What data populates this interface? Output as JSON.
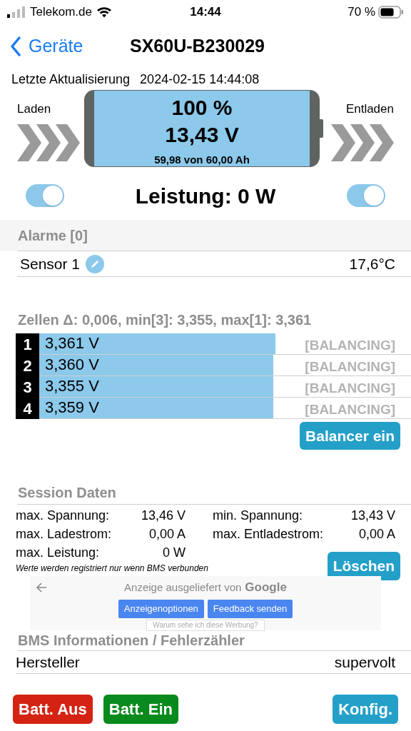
{
  "status_bar": {
    "carrier": "Telekom.de",
    "time": "14:44",
    "battery": "70 %"
  },
  "nav": {
    "back": "Geräte",
    "title": "SX60U-B230029"
  },
  "last_update": {
    "label": "Letzte Aktualisierung",
    "value": "2024-02-15 14:44:08"
  },
  "battery": {
    "percent": "100 %",
    "voltage": "13,43 V",
    "capacity": "59,98 von 60,00 Ah",
    "level": 1
  },
  "charge": {
    "label": "Laden",
    "on": true
  },
  "discharge": {
    "label": "Entladen",
    "on": true
  },
  "power": "Leistung: 0 W",
  "alarms": {
    "title": "Alarme [0]",
    "sensors": [
      {
        "name": "Sensor 1",
        "value": "17,6°C"
      }
    ]
  },
  "cells": {
    "title": "Zellen Δ: 0,006, min[3]: 3,355, max[1]: 3,361",
    "items": [
      {
        "index": "1",
        "voltage": "3,361 V",
        "level": 0.635,
        "status": "[BALANCING]",
        "balancing": false
      },
      {
        "index": "2",
        "voltage": "3,360 V",
        "level": 0.63,
        "status": "[BALANCING]",
        "balancing": false
      },
      {
        "index": "3",
        "voltage": "3,355 V",
        "level": 0.63,
        "status": "[BALANCING]",
        "balancing": false
      },
      {
        "index": "4",
        "voltage": "3,359 V",
        "level": 0.63,
        "status": "[BALANCING]",
        "balancing": false
      }
    ],
    "button": "Balancer ein"
  },
  "session": {
    "title": "Session Daten",
    "left": [
      {
        "label": "max. Spannung:",
        "value": "13,46 V"
      },
      {
        "label": "max. Ladestrom:",
        "value": "0,00 A"
      },
      {
        "label": "max. Leistung:",
        "value": "0 W"
      }
    ],
    "right": [
      {
        "label": "min. Spannung:",
        "value": "13,43 V"
      },
      {
        "label": "max. Entladestrom:",
        "value": "0,00 A"
      }
    ],
    "button": "Löschen",
    "note": "Werte werden registriert nur wenn BMS verbunden"
  },
  "ad": {
    "label": "Anzeige ausgeliefert von",
    "brand": "Google",
    "buttons": [
      "Anzeigenoptionen",
      "Feedback senden"
    ],
    "why": "Warum sehe ich diese Werbung?"
  },
  "bms": {
    "title": "BMS Informationen / Fehlerzähler",
    "rows": [
      {
        "label": "Hersteller",
        "value": "supervolt"
      }
    ]
  },
  "footer": [
    {
      "label": "Batt. Aus",
      "kind": "off"
    },
    {
      "label": "Batt. Ein",
      "kind": "on"
    },
    {
      "label": "Konfig.",
      "kind": "config"
    }
  ]
}
